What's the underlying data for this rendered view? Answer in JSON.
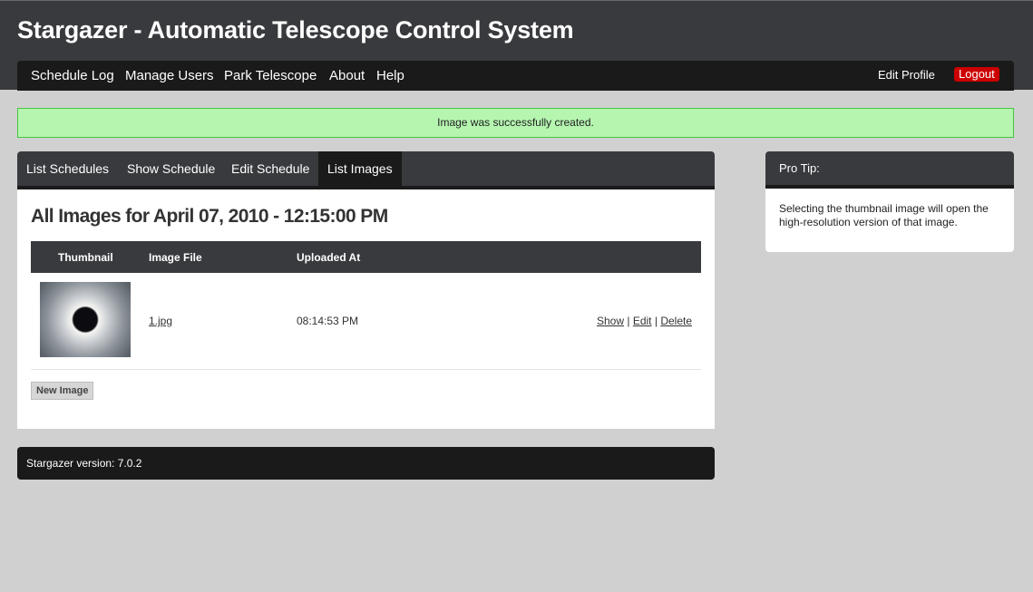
{
  "app": {
    "title": "Stargazer - Automatic Telescope Control System"
  },
  "nav": {
    "items": [
      "Schedule Log",
      "Manage Users",
      "Park Telescope",
      "About",
      "Help"
    ],
    "edit_profile": "Edit Profile",
    "logout": "Logout"
  },
  "flash": {
    "message": "Image was successfully created."
  },
  "tabs": [
    "List Schedules",
    "Show Schedule",
    "Edit Schedule",
    "List Images"
  ],
  "active_tab": "List Images",
  "page": {
    "heading": "All Images for April 07, 2010 - 12:15:00 PM"
  },
  "table": {
    "headers": [
      "Thumbnail",
      "Image File",
      "Uploaded At"
    ],
    "rows": [
      {
        "thumbnail": "solar-eclipse-image",
        "file": "1.jpg",
        "uploaded_at": "08:14:53 PM",
        "actions": [
          "Show",
          "Edit",
          "Delete"
        ]
      }
    ]
  },
  "new_image_button": "New Image",
  "footer": {
    "version_text": "Stargazer version: 7.0.2"
  },
  "tip": {
    "title": "Pro Tip:",
    "body": "Selecting the thumbnail image will open the high-resolution version of that image."
  },
  "colors": {
    "header_bg": "#393a3e",
    "nav_bg": "#1a1a1a",
    "logout_bg": "#cc0000",
    "flash_bg": "#b5f5b0",
    "flash_border": "#46c242",
    "page_bg": "#d0d0d0"
  }
}
